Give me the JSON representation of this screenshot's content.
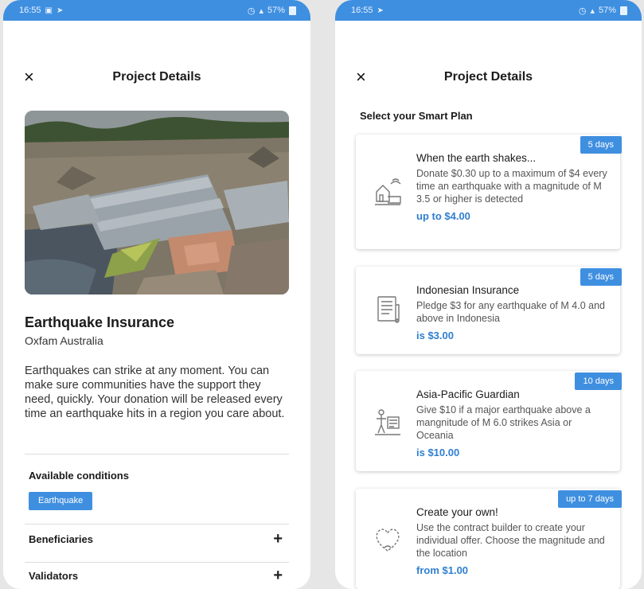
{
  "left": {
    "status": {
      "time": "16:55",
      "battery": "57%"
    },
    "header": {
      "close_icon": "×",
      "title": "Project Details"
    },
    "project": {
      "title": "Earthquake Insurance",
      "organization": "Oxfam Australia",
      "description": "Earthquakes can strike at any moment. You can make sure communities have the support they need, quickly. Your donation will be released every time an earthquake hits in a region you care about."
    },
    "conditions": {
      "label": "Available conditions",
      "chip": "Earthquake"
    },
    "sections": [
      {
        "label": "Beneficiaries",
        "icon": "+"
      },
      {
        "label": "Validators",
        "icon": "+"
      }
    ]
  },
  "right": {
    "status": {
      "time": "16:55",
      "battery": "57%"
    },
    "header": {
      "close_icon": "×",
      "title": "Project Details"
    },
    "subheading": "Select your Smart Plan",
    "plans": [
      {
        "badge": "5 days",
        "title": "When the earth shakes...",
        "description": "Donate $0.30 up to a maximum of $4 every time an earthquake with a magnitude of M 3.5 or higher is detected",
        "price": "up to $4.00",
        "icon": "house-shake-icon"
      },
      {
        "badge": "5 days",
        "title": "Indonesian Insurance",
        "description": "Pledge $3 for any earthquake of M 4.0 and above in Indonesia",
        "price": "is $3.00",
        "icon": "document-icon"
      },
      {
        "badge": "10 days",
        "title": "Asia-Pacific Guardian",
        "description": "Give $10 if a major earthquake above a mangnitude of M 6.0 strikes Asia or Oceania",
        "price": "is $10.00",
        "icon": "helper-icon"
      },
      {
        "badge": "up to 7 days",
        "title": "Create your own!",
        "description": "Use the contract builder to create your individual offer. Choose the magnitude and the location",
        "price": "from $1.00",
        "icon": "heart-icon"
      }
    ]
  },
  "colors": {
    "accent": "#3f8fe0",
    "price": "#2f7fd0",
    "background": "#e6e6e6"
  }
}
